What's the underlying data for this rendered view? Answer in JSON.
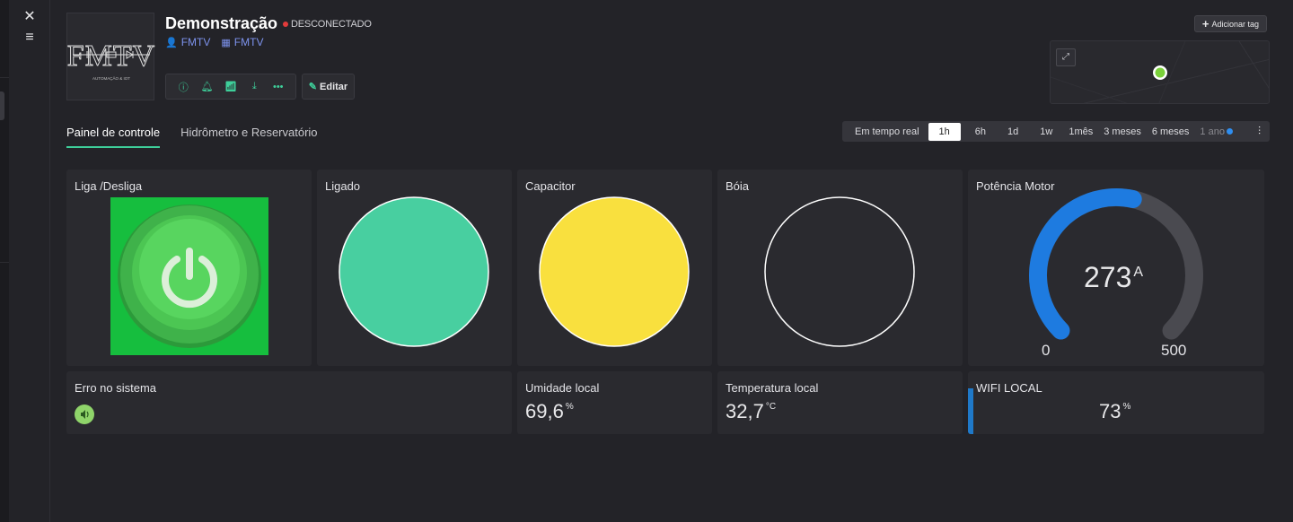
{
  "rail": {
    "close_icon": "close-icon",
    "menu_icon": "menu-icon"
  },
  "device": {
    "logo_text": "FMTV",
    "logo_subtitle": "AUTOMAÇÃO & IOT",
    "name": "Demonstração",
    "status": "DESCONECTADO",
    "status_color": "#e23b3b",
    "owner_user": "FMTV",
    "owner_org": "FMTV",
    "edit_label": "Editar"
  },
  "header": {
    "add_tag_label": "Adicionar tag"
  },
  "tabs": [
    {
      "label": "Painel de controle",
      "active": true
    },
    {
      "label": "Hidrômetro e Reservatório",
      "active": false
    }
  ],
  "time_range": {
    "options": [
      "Em tempo real",
      "1h",
      "6h",
      "1d",
      "1w",
      "1mês",
      "3 meses",
      "6 meses",
      "1 ano"
    ],
    "selected": "1h"
  },
  "widgets": {
    "liga_desliga": {
      "title": "Liga /Desliga"
    },
    "ligado": {
      "title": "Ligado",
      "color": "#48cfa0"
    },
    "capacitor": {
      "title": "Capacitor",
      "color": "#f9e03e"
    },
    "boia": {
      "title": "Bóia"
    },
    "potencia": {
      "title": "Potência Motor",
      "value": "273",
      "unit": "A",
      "min": "0",
      "max": "500",
      "fraction": 0.546,
      "color": "#1e7be0"
    },
    "erro": {
      "title": "Erro no sistema"
    },
    "umidade": {
      "title": "Umidade local",
      "value": "69,6",
      "unit": "%"
    },
    "temperatura": {
      "title": "Temperatura local",
      "value": "32,7",
      "unit": "°C"
    },
    "wifi": {
      "title": "WIFI LOCAL",
      "value": "73",
      "unit": "%",
      "fraction": 0.73
    }
  }
}
